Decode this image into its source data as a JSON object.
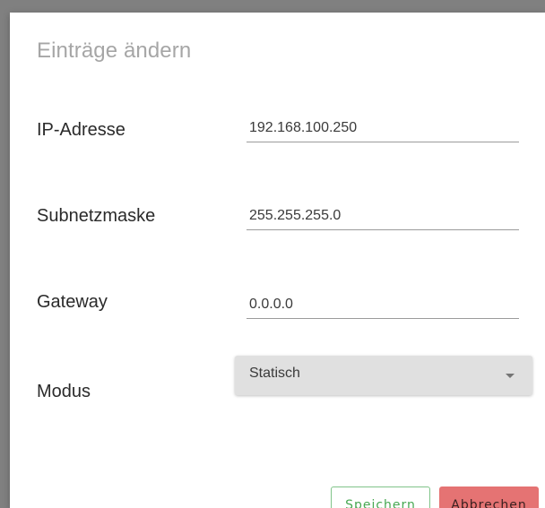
{
  "dialog": {
    "title": "Einträge ändern"
  },
  "fields": {
    "ip": {
      "label": "IP-Adresse",
      "value": "192.168.100.250"
    },
    "subnet": {
      "label": "Subnetzmaske",
      "value": "255.255.255.0"
    },
    "gateway": {
      "label": "Gateway",
      "value": "0.0.0.0"
    },
    "mode": {
      "label": "Modus",
      "value": "Statisch"
    }
  },
  "buttons": {
    "save_label": "Speichern",
    "cancel_label": "Abbrechen"
  },
  "colors": {
    "save": "#47a852",
    "cancel_bg": "#e57373",
    "title": "#a6a6a6"
  }
}
